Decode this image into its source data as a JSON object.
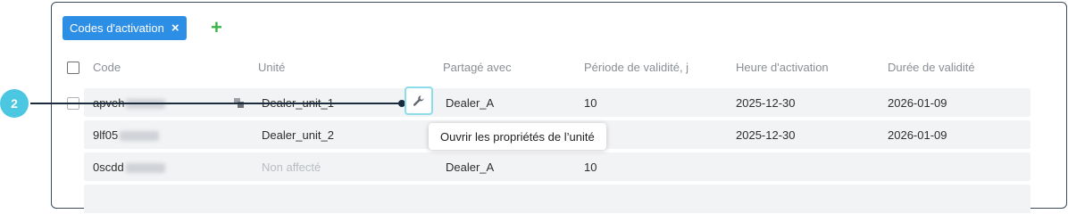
{
  "filter": {
    "chip_label": "Codes d'activation",
    "chip_close": "×",
    "add_label": "+"
  },
  "table": {
    "headers": [
      "Code",
      "Unité",
      "Partagé avec",
      "Période de validité, j",
      "Heure d'activation",
      "Durée de validité"
    ],
    "rows": [
      {
        "code": "apveh",
        "unit": "Dealer_unit_1",
        "shared": "Dealer_A",
        "period": "10",
        "activation": "2025-12-30",
        "validity": "2026-01-09"
      },
      {
        "code": "9lf05",
        "unit": "Dealer_unit_2",
        "shared": "",
        "period": "",
        "activation": "2025-12-30",
        "validity": "2026-01-09"
      },
      {
        "code": "0scdd",
        "unit": "Non affecté",
        "shared": "Dealer_A",
        "period": "10",
        "activation": "",
        "validity": ""
      }
    ]
  },
  "tooltip": {
    "text": "Ouvrir les propriétés de l’unité"
  },
  "callout": {
    "number": "2"
  },
  "icons": {
    "wrench": "wrench-icon",
    "copy": "copy-icon",
    "close": "close-icon",
    "plus": "plus-icon"
  },
  "colors": {
    "chip": "#2d8ee6",
    "plus": "#3bb54a",
    "badge": "#4cc7e1",
    "wrench_border": "#8cdcea",
    "panel_border": "#3b4a5c"
  }
}
